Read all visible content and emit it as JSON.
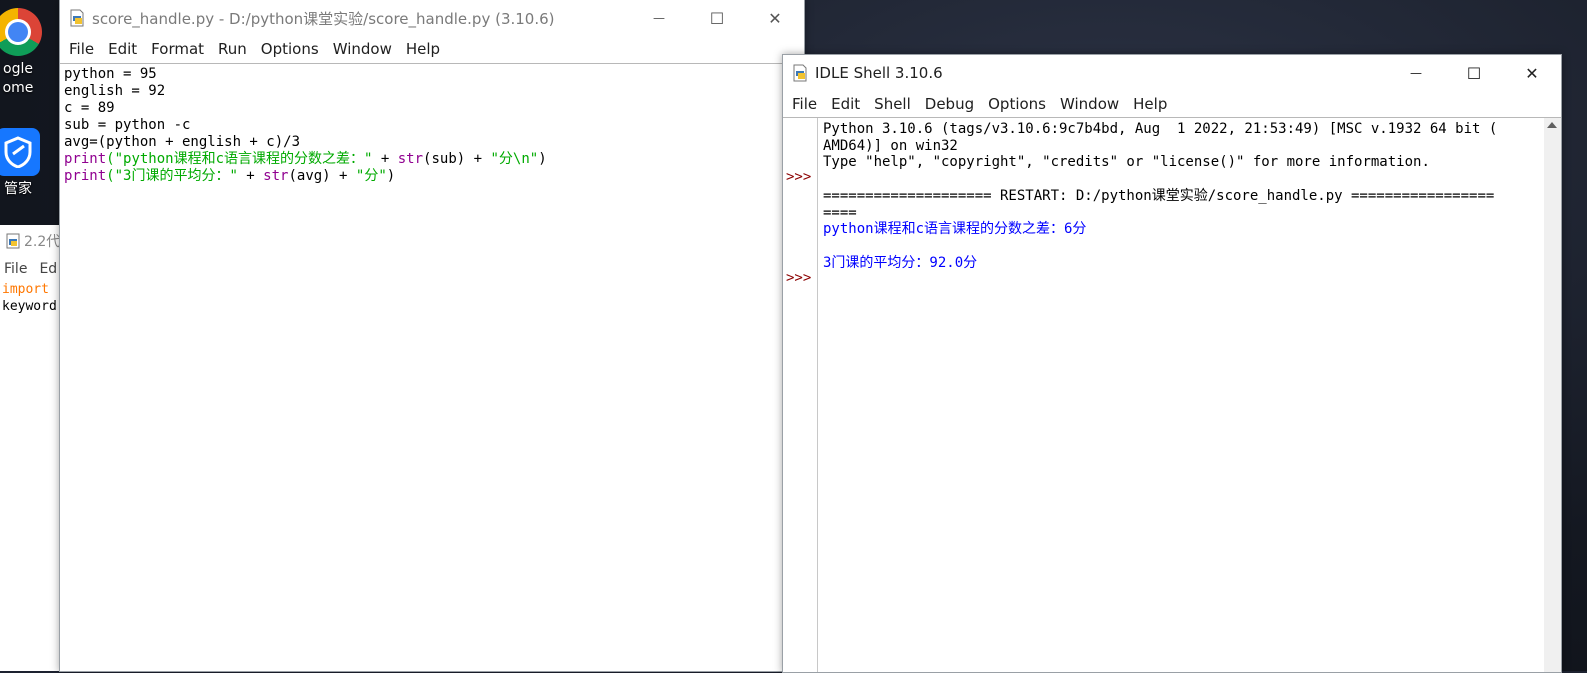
{
  "desktop": {
    "icons": [
      {
        "label_line1": "ogle",
        "label_line2": "ome",
        "icon": "chrome-icon"
      },
      {
        "label_line1": "管家",
        "icon": "shield-icon"
      }
    ],
    "bg_window": {
      "title": "2.2代",
      "menu": [
        "File",
        "Ed"
      ],
      "code": [
        "import",
        "keyword"
      ]
    }
  },
  "editor": {
    "title": "score_handle.py - D:/python课堂实验/score_handle.py (3.10.6)",
    "menu": [
      "File",
      "Edit",
      "Format",
      "Run",
      "Options",
      "Window",
      "Help"
    ],
    "lines": {
      "l1": "python = 95",
      "l2": "english = 92",
      "l3": "c = 89",
      "l4": "sub = python -c",
      "l5": "avg=(python + english + c)/3",
      "l6_print": "print",
      "l6_str1": "(\"python课程和c语言课程的分数之差：\"",
      "l6_plus1": " + ",
      "l6_str_fn": "str",
      "l6_arg": "(sub) + ",
      "l6_str2": "\"分\\n\"",
      "l6_end": ")",
      "l7_print": "print",
      "l7_str1": "(\"3门课的平均分：\"",
      "l7_plus1": " + ",
      "l7_str_fn": "str",
      "l7_arg": "(avg) + ",
      "l7_str2": "\"分\"",
      "l7_end": ")"
    }
  },
  "shell": {
    "title": "IDLE Shell 3.10.6",
    "menu": [
      "File",
      "Edit",
      "Shell",
      "Debug",
      "Options",
      "Window",
      "Help"
    ],
    "prompt": ">>>",
    "banner1": "Python 3.10.6 (tags/v3.10.6:9c7b4bd, Aug  1 2022, 21:53:49) [MSC v.1932 64 bit (",
    "banner2": "AMD64)] on win32",
    "banner3": "Type \"help\", \"copyright\", \"credits\" or \"license()\" for more information.",
    "restart1": "==================== RESTART: D:/python课堂实验/score_handle.py =================",
    "restart2": "====",
    "out1": "python课程和c语言课程的分数之差：6分",
    "out2": "3门课的平均分：92.0分"
  },
  "controls": {
    "minimize": "—",
    "maximize": "☐",
    "close": "✕"
  }
}
